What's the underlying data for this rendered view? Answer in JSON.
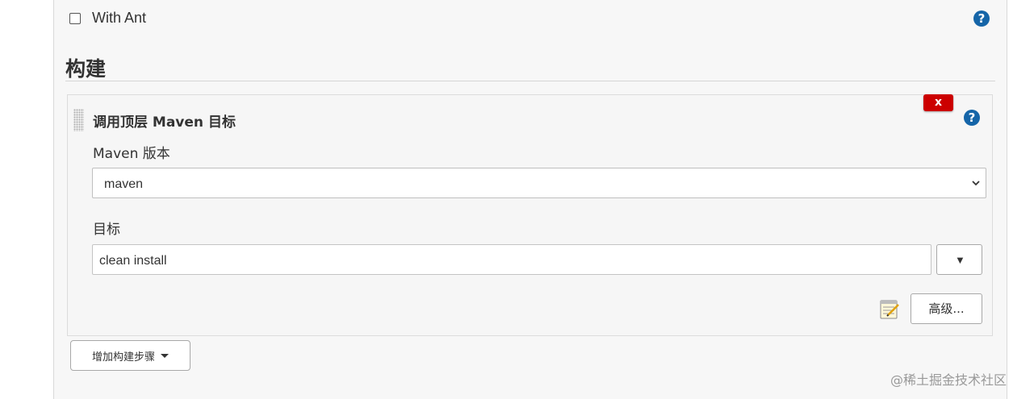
{
  "publisher": {
    "with_ant_label": "With Ant",
    "with_ant_checked": false
  },
  "section": {
    "title": "构建"
  },
  "build_step": {
    "title": "调用顶层 Maven 目标",
    "delete_label": "x",
    "maven_version_label": "Maven 版本",
    "maven_version_selected": "maven",
    "goals_label": "目标",
    "goals_value": "clean install",
    "expand_label": "▼",
    "advanced_label": "高级..."
  },
  "add_step_button": {
    "label": "增加构建步骤"
  },
  "watermark": {
    "text": "@稀土掘金技术社区"
  },
  "icons": {
    "help": "help-icon",
    "drag": "drag-handle-icon",
    "notepad": "notepad-icon",
    "chevron": "chevron-down-icon"
  },
  "colors": {
    "help_blue": "#1565a8",
    "delete_red": "#cc0000",
    "panel_bg": "#f7f7f7"
  }
}
